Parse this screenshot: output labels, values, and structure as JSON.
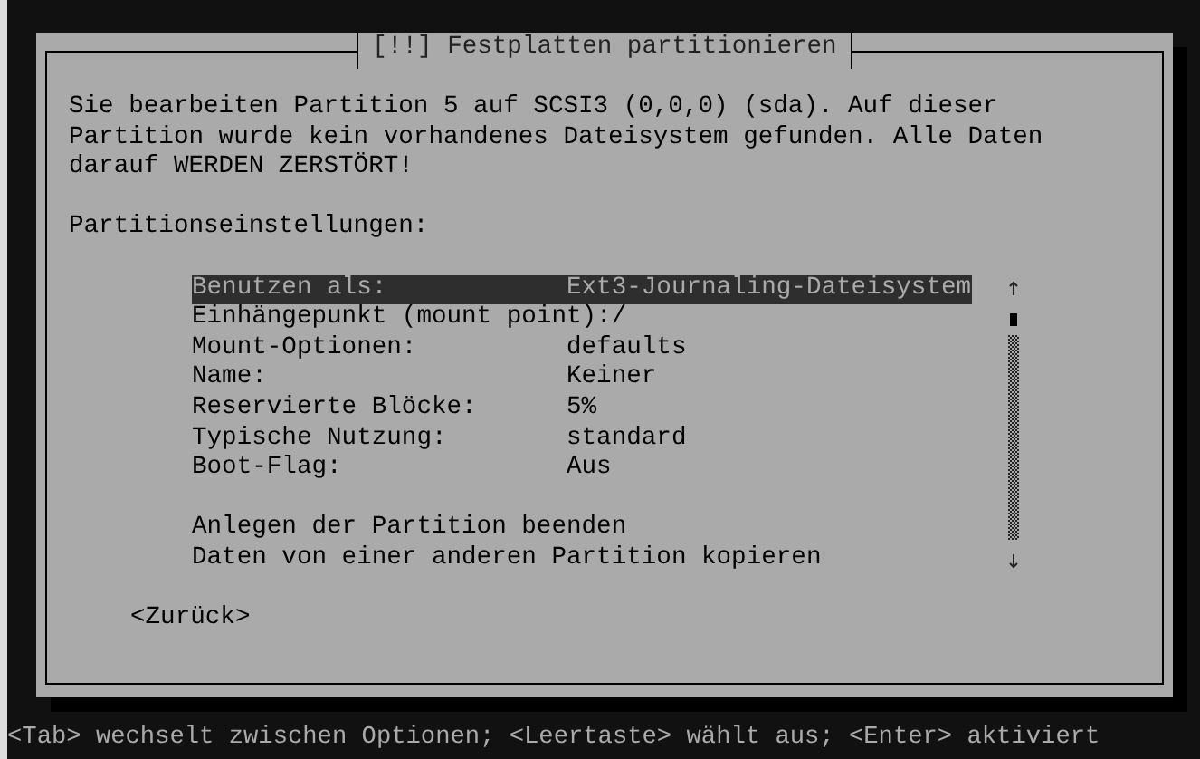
{
  "dialog": {
    "title": "[!!] Festplatten partitionieren",
    "message": [
      "Sie bearbeiten Partition 5 auf SCSI3 (0,0,0) (sda). Auf dieser",
      "Partition wurde kein vorhandenes Dateisystem gefunden. Alle Daten",
      "darauf WERDEN ZERSTÖRT!"
    ],
    "section_label": "Partitionseinstellungen:",
    "items": [
      {
        "kind": "setting",
        "label": "Benutzen als:",
        "value": "Ext3-Journaling-Dateisystem",
        "selected": true
      },
      {
        "kind": "setting",
        "label": "Einhängepunkt (mount point):",
        "value": "/",
        "selected": false
      },
      {
        "kind": "setting",
        "label": "Mount-Optionen:",
        "value": "defaults",
        "selected": false
      },
      {
        "kind": "setting",
        "label": "Name:",
        "value": "Keiner",
        "selected": false
      },
      {
        "kind": "setting",
        "label": "Reservierte Blöcke:",
        "value": "5%",
        "selected": false
      },
      {
        "kind": "setting",
        "label": "Typische Nutzung:",
        "value": "standard",
        "selected": false
      },
      {
        "kind": "setting",
        "label": "Boot-Flag:",
        "value": "Aus",
        "selected": false
      },
      {
        "kind": "spacer"
      },
      {
        "kind": "action",
        "label": "Anlegen der Partition beenden",
        "selected": false
      },
      {
        "kind": "action",
        "label": "Daten von einer anderen Partition kopieren",
        "selected": false
      }
    ],
    "back_button": "<Zurück>"
  },
  "status_bar": "<Tab> wechselt zwischen Optionen; <Leertaste> wählt aus; <Enter> aktiviert"
}
